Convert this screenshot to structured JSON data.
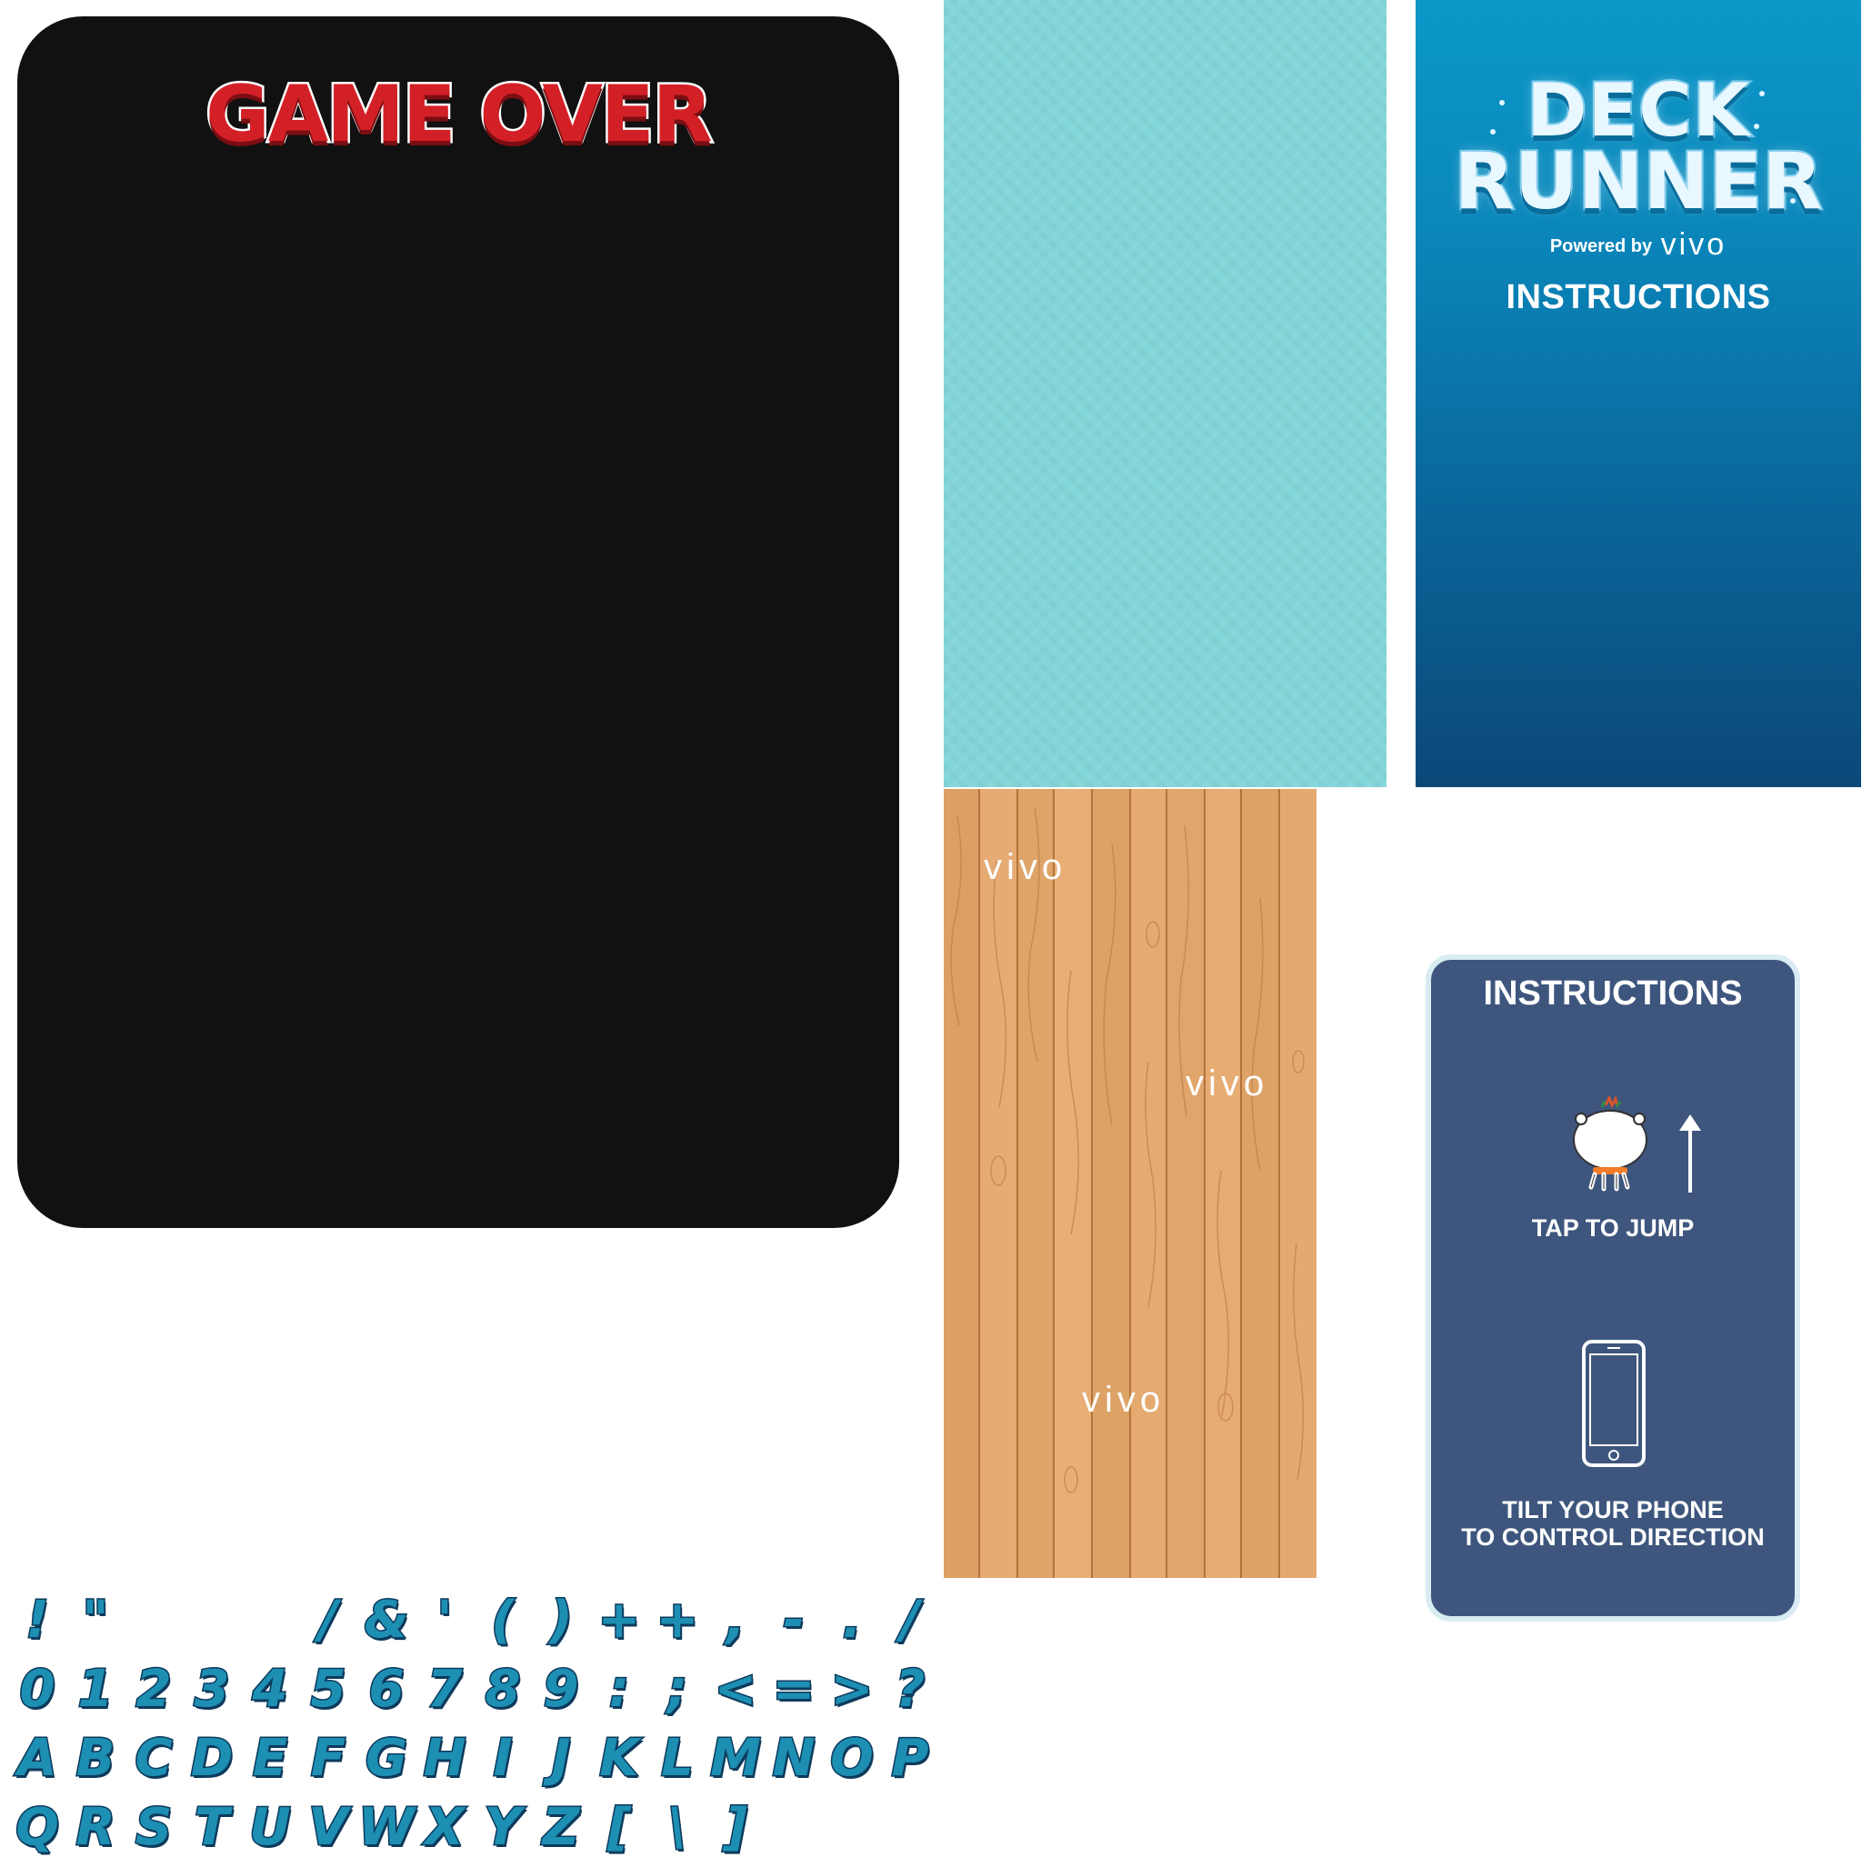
{
  "game_over": {
    "title": "GAME OVER"
  },
  "title_screen": {
    "logo_line1": "DECK",
    "logo_line2": "RUNNER",
    "powered_by": "Powered by",
    "brand": "vivo",
    "instructions_heading": "INSTRUCTIONS"
  },
  "wood_panel": {
    "brand_marks": [
      "vivo",
      "vivo",
      "vivo"
    ]
  },
  "instructions_card": {
    "title": "INSTRUCTIONS",
    "tap_label": "TAP TO JUMP",
    "tilt_line1": "TILT YOUR PHONE",
    "tilt_line2": "TO CONTROL DIRECTION"
  },
  "font_sheet": {
    "row1": [
      "!",
      "\"",
      "",
      "",
      "",
      "/",
      "&",
      "'",
      "(",
      ")",
      "+",
      "+",
      ",",
      "-",
      ".",
      "/"
    ],
    "row2": [
      "0",
      "1",
      "2",
      "3",
      "4",
      "5",
      "6",
      "7",
      "8",
      "9",
      ":",
      ";",
      "<",
      "=",
      ">",
      "?"
    ],
    "row3": [
      "A",
      "B",
      "C",
      "D",
      "E",
      "F",
      "G",
      "H",
      "I",
      "J",
      "K",
      "L",
      "M",
      "N",
      "O",
      "P"
    ],
    "row4": [
      "Q",
      "R",
      "S",
      "T",
      "U",
      "V",
      "W",
      "X",
      "Y",
      "Z",
      "[",
      "\\",
      "]"
    ]
  },
  "colors": {
    "game_over_red": "#d32027",
    "panel_black": "#111111",
    "water": "#82d5d8",
    "ocean_top": "#0b98c9",
    "ocean_bottom": "#0b4878",
    "wood": "#e2a66b",
    "card_blue": "#3e567d",
    "glyph_fill": "#1d8fb3"
  }
}
